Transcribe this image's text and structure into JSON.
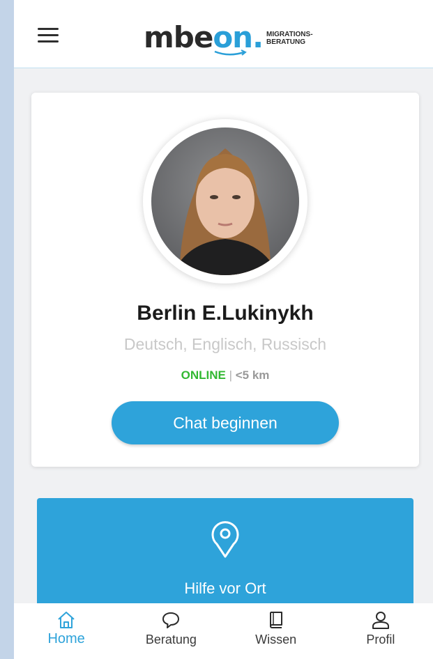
{
  "header": {
    "logo_main": "mbe",
    "logo_accent": "on.",
    "logo_sub_line1": "MIGRATIONS-",
    "logo_sub_line2": "BERATUNG",
    "menu_icon": "hamburger-menu-icon"
  },
  "profile": {
    "name": "Berlin E.Lukinykh",
    "languages": "Deutsch, Englisch, Russisch",
    "status": "ONLINE",
    "separator": "|",
    "distance": "<5 km",
    "chat_button": "Chat beginnen"
  },
  "help_card": {
    "icon": "location-pin-icon",
    "label": "Hilfe vor Ort"
  },
  "bottom_nav": {
    "items": [
      {
        "label": "Home",
        "icon": "home-icon",
        "active": true
      },
      {
        "label": "Beratung",
        "icon": "chat-bubble-icon",
        "active": false
      },
      {
        "label": "Wissen",
        "icon": "book-icon",
        "active": false
      },
      {
        "label": "Profil",
        "icon": "user-icon",
        "active": false
      }
    ]
  },
  "colors": {
    "accent": "#2ea3da",
    "online": "#32b832",
    "background": "#f0f1f3"
  }
}
